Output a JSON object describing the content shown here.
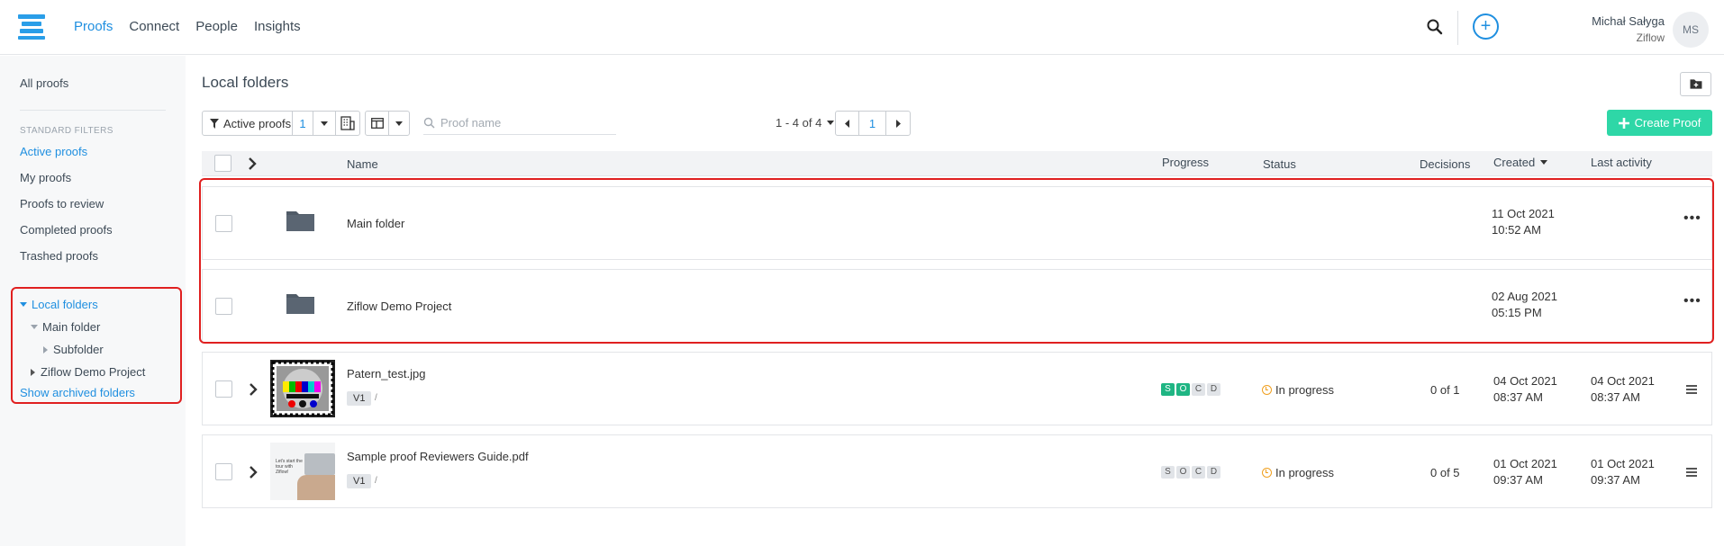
{
  "header": {
    "nav": [
      "Proofs",
      "Connect",
      "People",
      "Insights"
    ],
    "user_name": "Michał Sałyga",
    "user_org": "Ziflow",
    "avatar_initials": "MS"
  },
  "sidebar": {
    "all_proofs": "All proofs",
    "filters_heading": "STANDARD FILTERS",
    "filters": [
      "Active proofs",
      "My proofs",
      "Proofs to review",
      "Completed proofs",
      "Trashed proofs"
    ],
    "local_folders": "Local folders",
    "main_folder": "Main folder",
    "subfolder": "Subfolder",
    "demo_project": "Ziflow Demo Project",
    "show_archived": "Show archived folders"
  },
  "main": {
    "title": "Local folders",
    "filter_label": "Active proofs",
    "filter_count": "1",
    "search_placeholder": "Proof name",
    "pager_label": "1 - 4 of 4",
    "current_page": "1",
    "create_label": "Create Proof"
  },
  "table": {
    "columns": [
      "Name",
      "Progress",
      "Status",
      "Decisions",
      "Created",
      "Last activity"
    ],
    "folders": [
      {
        "name": "Main folder",
        "created_date": "11 Oct 2021",
        "created_time": "10:52 AM"
      },
      {
        "name": "Ziflow Demo Project",
        "created_date": "02 Aug 2021",
        "created_time": "05:15 PM"
      }
    ],
    "proofs": [
      {
        "name": "Patern_test.jpg",
        "version": "V1",
        "slash": "/",
        "steps": [
          "S",
          "O",
          "C",
          "D"
        ],
        "steps_done": 2,
        "status": "In progress",
        "decisions": "0 of 1",
        "created_date": "04 Oct 2021",
        "created_time": "08:37 AM",
        "activity_date": "04 Oct 2021",
        "activity_time": "08:37 AM"
      },
      {
        "name": "Sample proof Reviewers Guide.pdf",
        "version": "V1",
        "slash": "/",
        "steps": [
          "S",
          "O",
          "C",
          "D"
        ],
        "steps_done": 0,
        "status": "In progress",
        "decisions": "0 of 5",
        "created_date": "01 Oct 2021",
        "created_time": "09:37 AM",
        "activity_date": "01 Oct 2021",
        "activity_time": "09:37 AM",
        "thumb_text": "Let's start the tour with Ziflow!"
      }
    ]
  },
  "colors": {
    "accent": "#1f8fe0",
    "create": "#2ed7a7",
    "done_step": "#1fb583",
    "highlight": "#e02020"
  }
}
